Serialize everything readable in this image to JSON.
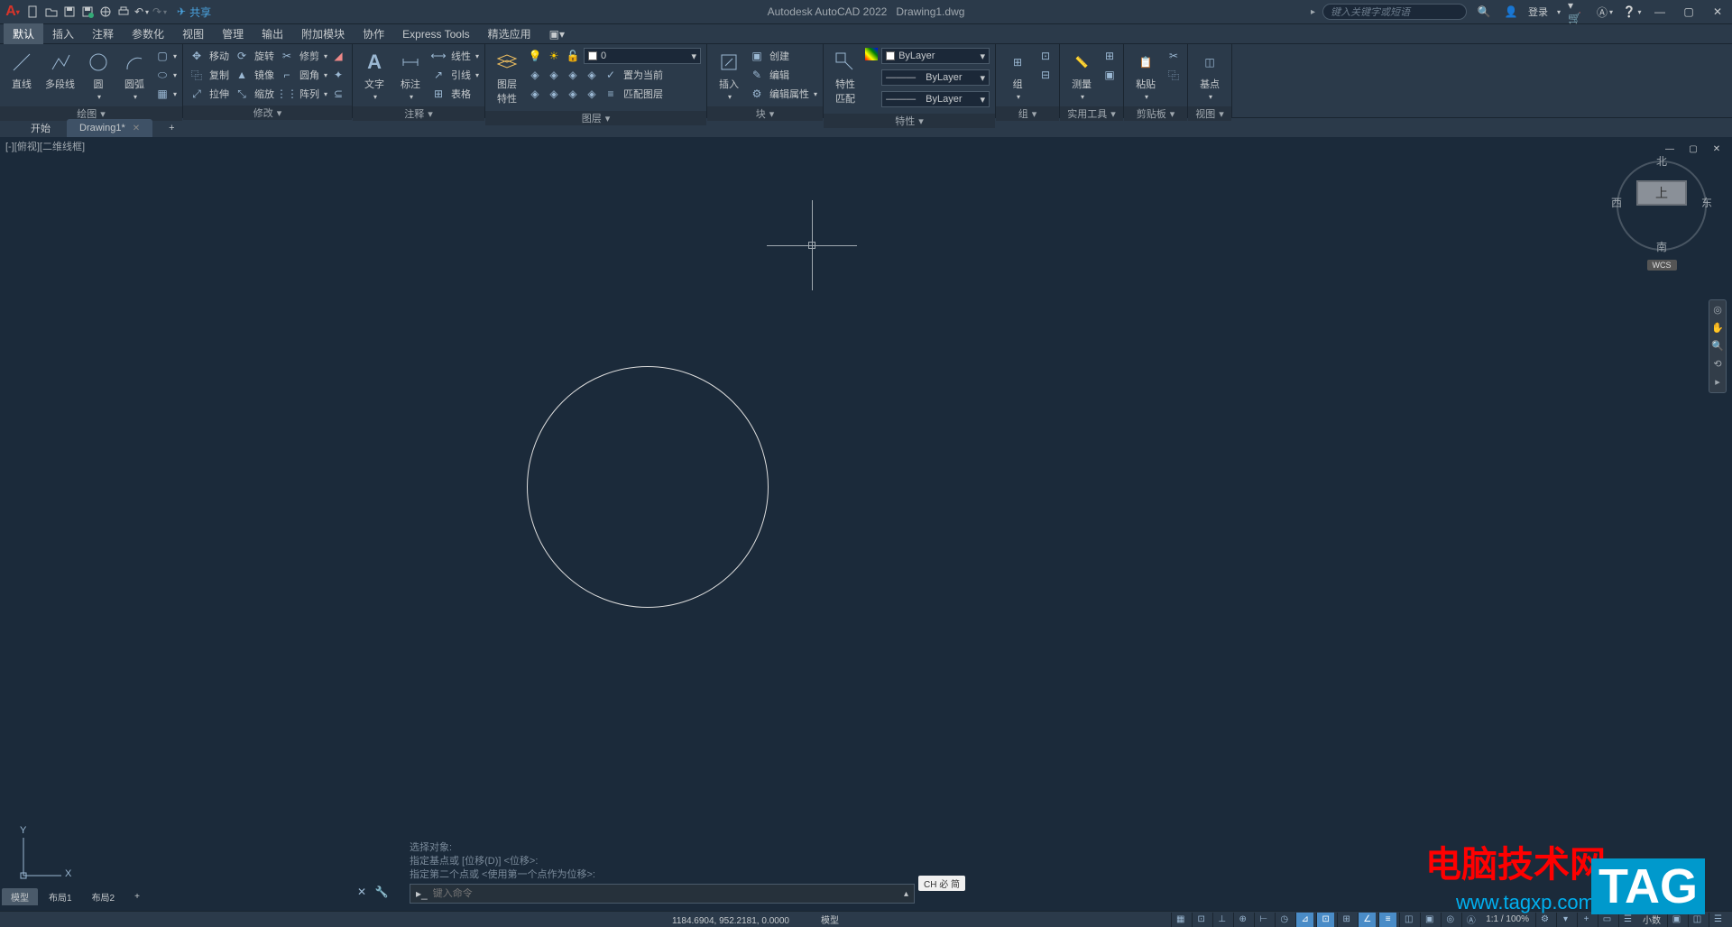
{
  "title_bar": {
    "app_title": "Autodesk AutoCAD 2022",
    "file_name": "Drawing1.dwg",
    "share_label": "共享",
    "search_placeholder": "键入关键字或短语",
    "login_label": "登录"
  },
  "menu_tabs": [
    "默认",
    "插入",
    "注释",
    "参数化",
    "视图",
    "管理",
    "输出",
    "附加模块",
    "协作",
    "Express Tools",
    "精选应用"
  ],
  "ribbon": {
    "panel_draw": {
      "title": "绘图",
      "line": "直线",
      "polyline": "多段线",
      "circle": "圆",
      "arc": "圆弧"
    },
    "panel_modify": {
      "title": "修改",
      "move": "移动",
      "rotate": "旋转",
      "trim": "修剪",
      "copy": "复制",
      "mirror": "镜像",
      "fillet": "圆角",
      "stretch": "拉伸",
      "scale": "缩放",
      "array": "阵列"
    },
    "panel_annot": {
      "title": "注释",
      "text": "文字",
      "dim": "标注",
      "leader": "引线",
      "table": "表格",
      "line_type": "线性"
    },
    "panel_layer": {
      "title": "图层",
      "layer_prop": "图层\n特性",
      "layer_value": "0",
      "set_current": "置为当前",
      "match": "匹配图层"
    },
    "panel_block": {
      "title": "块",
      "insert": "插入",
      "create": "创建",
      "edit": "编辑",
      "edit_attr": "编辑属性"
    },
    "panel_props": {
      "title": "特性",
      "match": "特性\n匹配",
      "layer": "ByLayer",
      "linetype": "ByLayer",
      "lineweight": "ByLayer"
    },
    "panel_group": {
      "title": "组",
      "group": "组"
    },
    "panel_util": {
      "title": "实用工具",
      "measure": "测量"
    },
    "panel_clip": {
      "title": "剪贴板",
      "paste": "粘贴"
    },
    "panel_view": {
      "title": "视图",
      "base": "基点"
    }
  },
  "file_tabs": {
    "start": "开始",
    "drawing": "Drawing1*"
  },
  "canvas": {
    "header": "[-][俯视][二维线框]",
    "viewcube": {
      "top": "上",
      "n": "北",
      "e": "东",
      "s": "南",
      "w": "西",
      "wcs": "WCS"
    },
    "ucs": {
      "x": "X",
      "y": "Y"
    },
    "cmd_history": [
      "选择对象:",
      "指定基点或 [位移(D)] <位移>:",
      "指定第二个点或 <使用第一个点作为位移>:"
    ],
    "cmd_placeholder": "键入命令",
    "ime": "CH 必 简"
  },
  "layout_tabs": [
    "模型",
    "布局1",
    "布局2"
  ],
  "status": {
    "coords": "1184.6904, 952.2181, 0.0000",
    "model": "模型",
    "scale": "1:1 / 100%",
    "decimal": "小数"
  },
  "watermark": {
    "text1": "电脑技术网",
    "text2": "TAG",
    "url": "www.tagxp.com"
  }
}
